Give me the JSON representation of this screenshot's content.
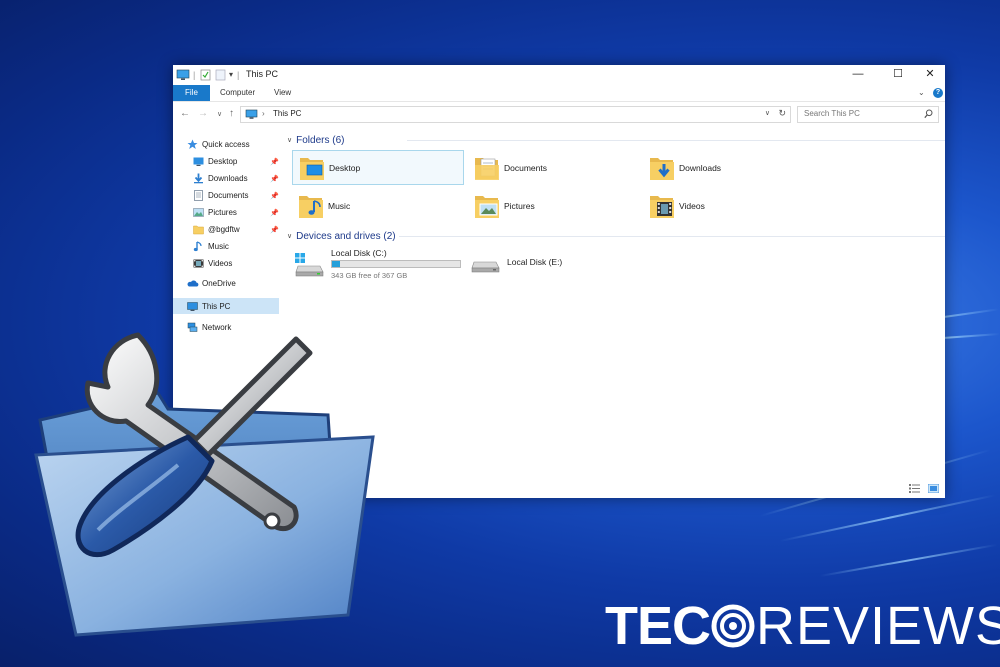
{
  "window": {
    "title": "This PC",
    "tabs": [
      "File",
      "Computer",
      "View"
    ],
    "address": "This PC",
    "search_placeholder": "Search This PC",
    "controls": {
      "minimize": "—",
      "maximize": "☐",
      "close": "✕"
    }
  },
  "navigation": {
    "quick_access": "Quick access",
    "items": [
      {
        "label": "Desktop",
        "icon": "desktop-icon",
        "pinned": true
      },
      {
        "label": "Downloads",
        "icon": "downloads-icon",
        "pinned": true
      },
      {
        "label": "Documents",
        "icon": "documents-icon",
        "pinned": true
      },
      {
        "label": "Pictures",
        "icon": "pictures-icon",
        "pinned": true
      },
      {
        "label": "@bgdftw",
        "icon": "folder-icon",
        "pinned": true
      },
      {
        "label": "Music",
        "icon": "music-icon",
        "pinned": false
      },
      {
        "label": "Videos",
        "icon": "videos-icon",
        "pinned": false
      }
    ],
    "onedrive": "OneDrive",
    "this_pc": "This PC",
    "network": "Network"
  },
  "content": {
    "folders_header": "Folders (6)",
    "folders": [
      "Desktop",
      "Documents",
      "Downloads",
      "Music",
      "Pictures",
      "Videos"
    ],
    "drives_header": "Devices and drives (2)",
    "drives": [
      {
        "label": "Local Disk (C:)",
        "free_text": "343 GB free of 367 GB",
        "used_fraction": 0.065
      },
      {
        "label": "Local Disk (E:)"
      }
    ]
  },
  "brand": {
    "logo_part1": "TEC",
    "logo_part2": "REVIEWS"
  },
  "colors": {
    "accent": "#1979ca",
    "folder": "#f7cf63",
    "desktop_bg": "#1c56cc"
  }
}
